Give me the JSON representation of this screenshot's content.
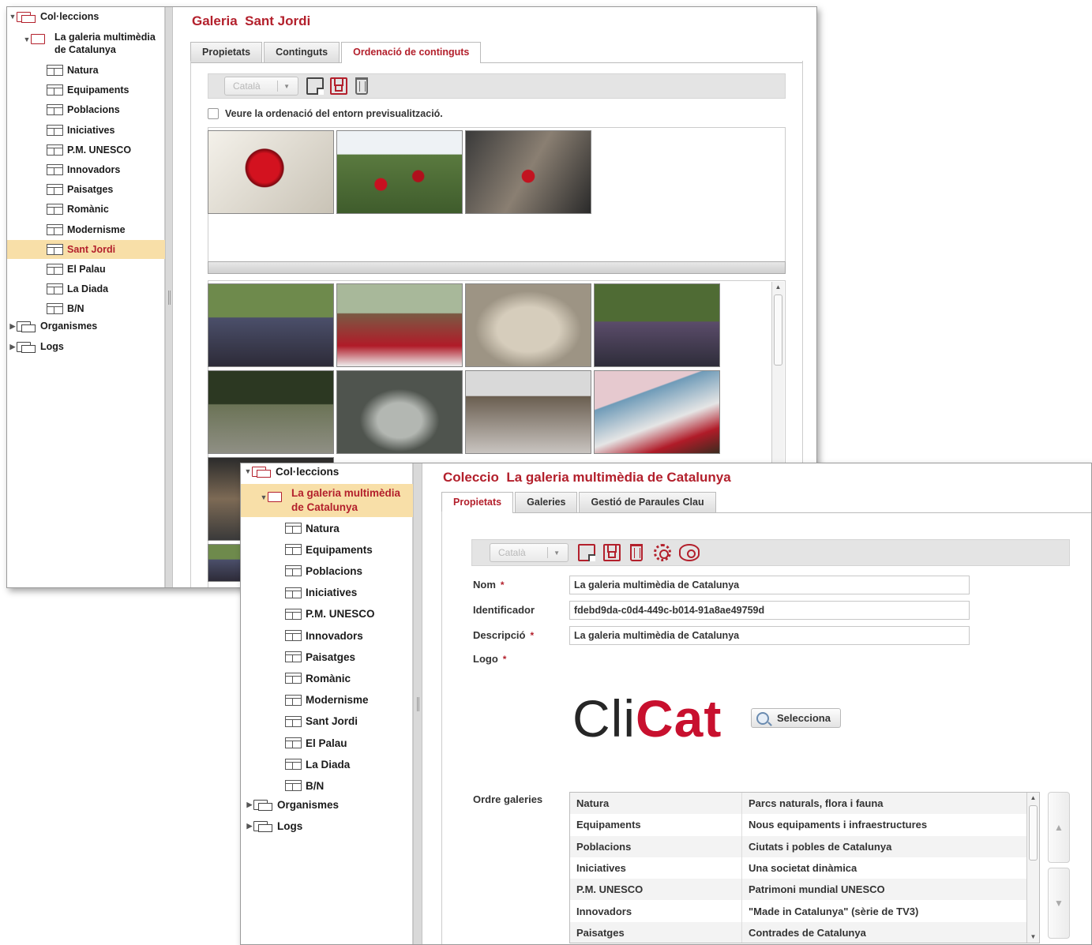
{
  "window1": {
    "tree": {
      "root": "Col·leccions",
      "collection": "La galeria multimèdia de Catalunya",
      "galleries": [
        "Natura",
        "Equipaments",
        "Poblacions",
        "Iniciatives",
        "P.M. UNESCO",
        "Innovadors",
        "Paisatges",
        "Romànic",
        "Modernisme",
        "Sant Jordi",
        "El Palau",
        "La Diada",
        "B/N"
      ],
      "selected": "Sant Jordi",
      "others": [
        "Organismes",
        "Logs"
      ]
    },
    "title_prefix": "Galeria",
    "title_name": "Sant Jordi",
    "tabs": [
      "Propietats",
      "Continguts",
      "Ordenació de continguts"
    ],
    "active_tab": "Ordenació de continguts",
    "language": "Català",
    "preview_checkbox": "Veure la ordenació del entorn previsualització."
  },
  "window2": {
    "tree": {
      "root": "Col·leccions",
      "collection": "La galeria multimèdia de Catalunya",
      "galleries": [
        "Natura",
        "Equipaments",
        "Poblacions",
        "Iniciatives",
        "P.M. UNESCO",
        "Innovadors",
        "Paisatges",
        "Romànic",
        "Modernisme",
        "Sant Jordi",
        "El Palau",
        "La Diada",
        "B/N"
      ],
      "others": [
        "Organismes",
        "Logs"
      ]
    },
    "title_prefix": "Coleccio",
    "title_name": "La galeria multimèdia de Catalunya",
    "tabs": [
      "Propietats",
      "Galeries",
      "Gestió de Paraules Clau"
    ],
    "active_tab": "Propietats",
    "language": "Català",
    "form": {
      "nom_label": "Nom",
      "nom_value": "La galeria multimèdia de Catalunya",
      "id_label": "Identificador",
      "id_value": "fdebd9da-c0d4-449c-b014-91a8ae49759d",
      "desc_label": "Descripció",
      "desc_value": "La galeria multimèdia de Catalunya",
      "logo_label": "Logo",
      "required_mark": "*"
    },
    "logo_text_1": "Cli",
    "logo_text_2": "Cat",
    "select_button": "Selecciona",
    "galleries_label": "Ordre galeries",
    "gallery_order": [
      {
        "name": "Natura",
        "desc": "Parcs naturals, flora i fauna"
      },
      {
        "name": "Equipaments",
        "desc": "Nous equipaments i infraestructures"
      },
      {
        "name": "Poblacions",
        "desc": "Ciutats i pobles de Catalunya"
      },
      {
        "name": "Iniciatives",
        "desc": "Una societat dinàmica"
      },
      {
        "name": "P.M. UNESCO",
        "desc": "Patrimoni mundial UNESCO"
      },
      {
        "name": "Innovadors",
        "desc": "\"Made in Catalunya\" (sèrie de TV3)"
      },
      {
        "name": "Paisatges",
        "desc": "Contrades de Catalunya"
      }
    ]
  },
  "colors": {
    "accent": "#b3202c",
    "selection": "#f8dfa8",
    "toolbar": "#e4e4e4"
  },
  "icons": [
    "folder-icon",
    "gallery-icon",
    "new-icon",
    "save-icon",
    "delete-icon",
    "settings-icon",
    "preview-icon",
    "search-icon"
  ]
}
